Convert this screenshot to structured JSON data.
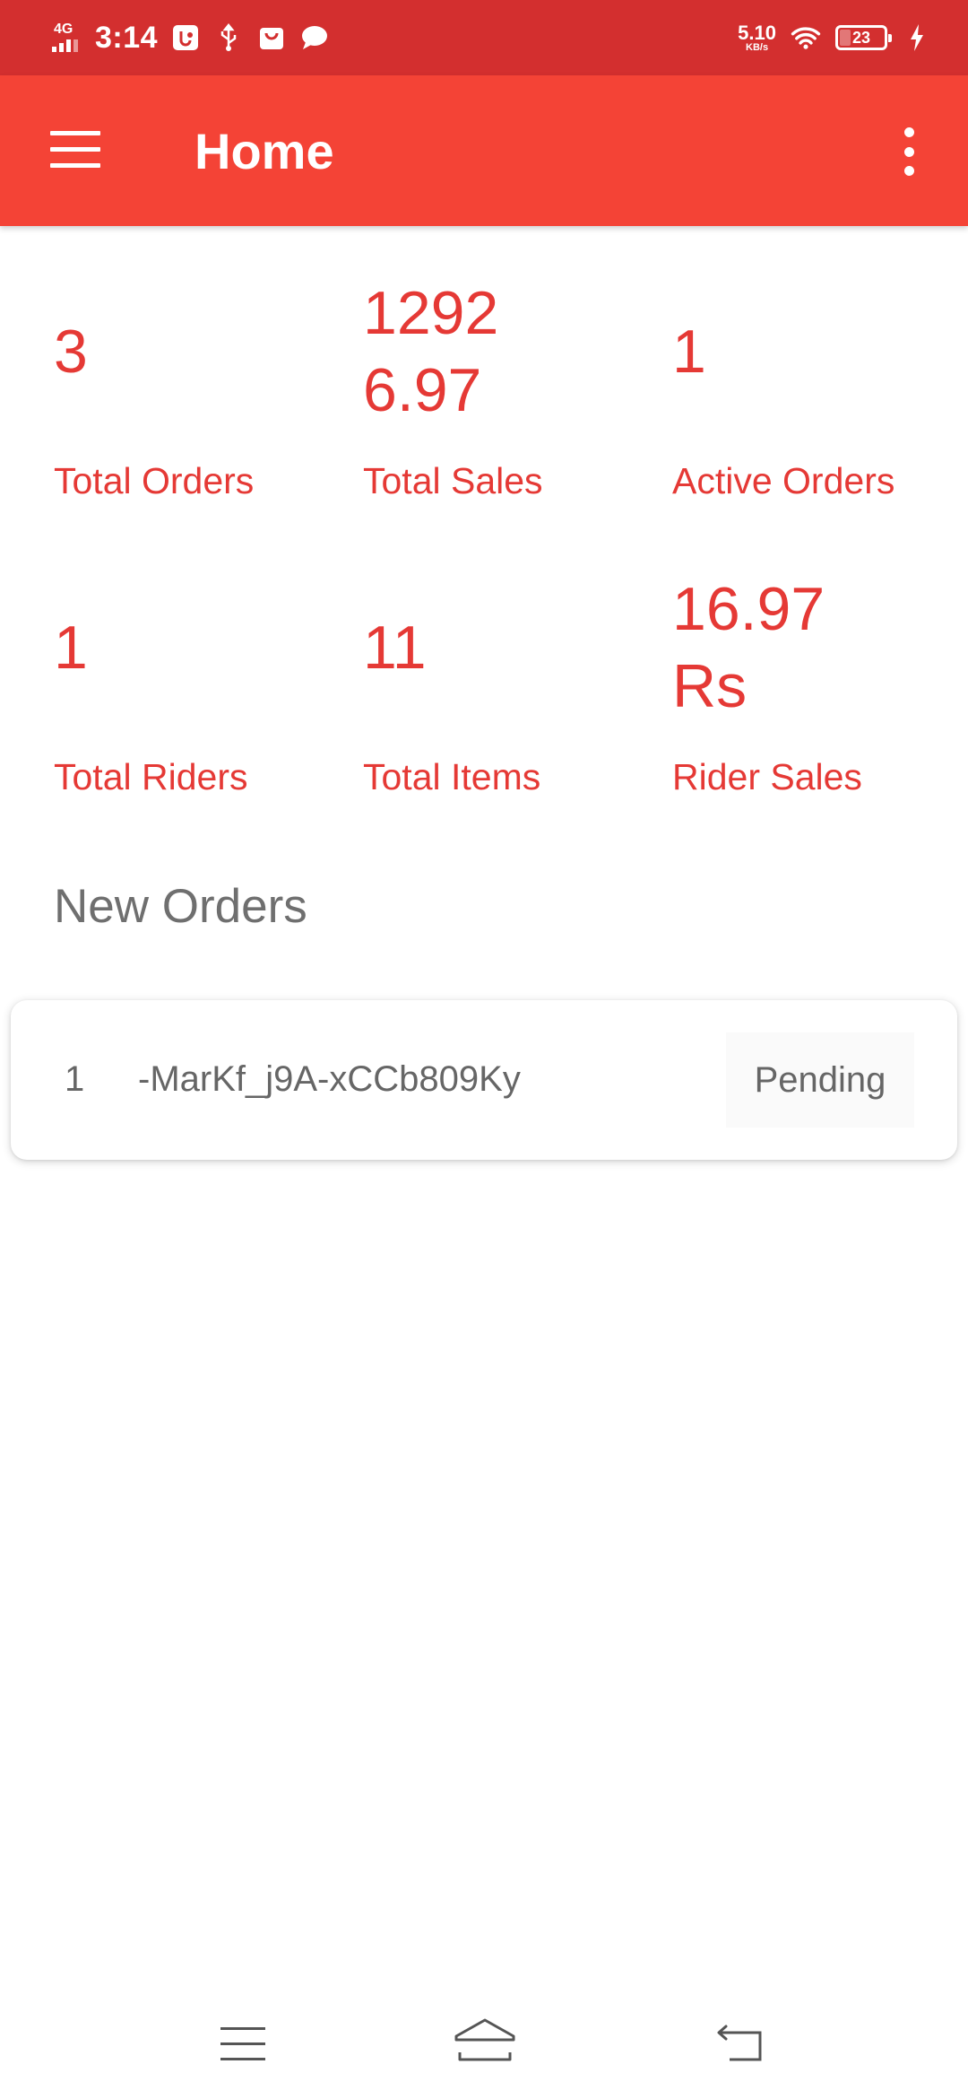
{
  "status_bar": {
    "network": "4G",
    "time": "3:14",
    "speed_value": "5.10",
    "speed_unit": "KB/s",
    "battery": "23"
  },
  "app_bar": {
    "title": "Home"
  },
  "stats": [
    {
      "value_line1": "3",
      "value_line2": "",
      "label": "Total Orders"
    },
    {
      "value_line1": "1292",
      "value_line2": "6.97",
      "label": "Total Sales"
    },
    {
      "value_line1": "1",
      "value_line2": "",
      "label": "Active Orders"
    },
    {
      "value_line1": "1",
      "value_line2": "",
      "label": "Total Riders"
    },
    {
      "value_line1": "11",
      "value_line2": "",
      "label": "Total Items"
    },
    {
      "value_line1": "16.97",
      "value_line2": "Rs",
      "label": "Rider Sales"
    }
  ],
  "new_orders": {
    "title": "New Orders",
    "items": [
      {
        "number": "1",
        "id": "-MarKf_j9A-xCCb809Ky",
        "status": "Pending"
      }
    ]
  },
  "colors": {
    "status_bar": "#d32f2f",
    "app_bar": "#f44336",
    "accent_text": "#e53935"
  }
}
